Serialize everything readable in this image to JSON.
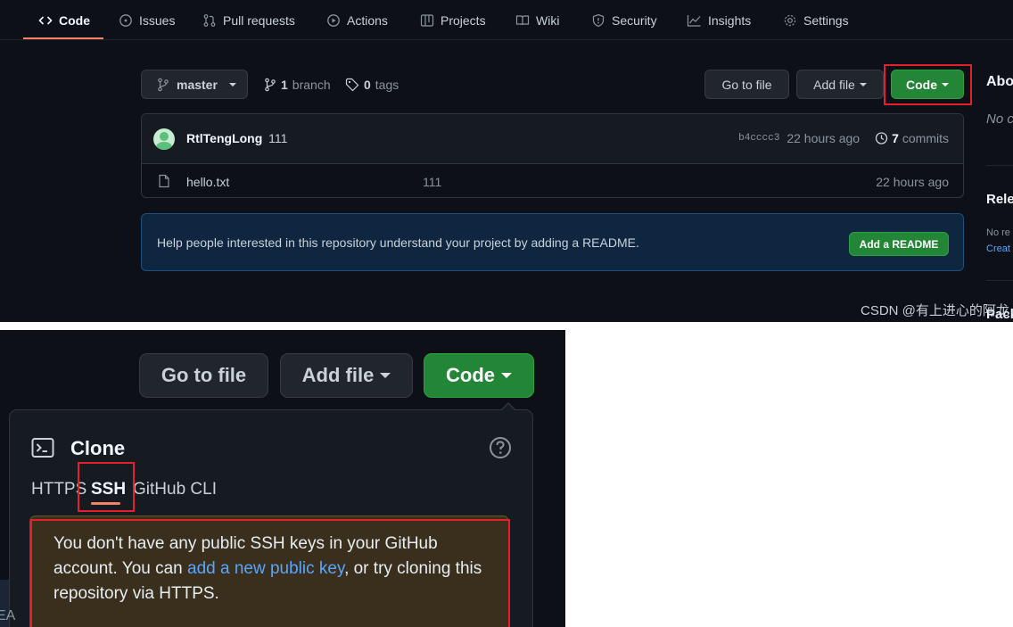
{
  "top": {
    "nav_tabs": [
      {
        "label": "Code",
        "icon": "code-icon",
        "active": true
      },
      {
        "label": "Issues",
        "icon": "issue-icon"
      },
      {
        "label": "Pull requests",
        "icon": "pull-request-icon"
      },
      {
        "label": "Actions",
        "icon": "play-icon"
      },
      {
        "label": "Projects",
        "icon": "table-icon"
      },
      {
        "label": "Wiki",
        "icon": "book-icon"
      },
      {
        "label": "Security",
        "icon": "shield-icon"
      },
      {
        "label": "Insights",
        "icon": "graph-icon"
      },
      {
        "label": "Settings",
        "icon": "gear-icon"
      }
    ],
    "branch_select": "master",
    "branch_count": "1",
    "branch_label": "branch",
    "tag_count": "0",
    "tag_label": "tags",
    "go_to_file": "Go to file",
    "add_file": "Add file",
    "code_button": "Code",
    "commit": {
      "author": "RtlTengLong",
      "message": "111",
      "hash": "b4cccc3",
      "time": "22 hours ago",
      "commits_count": "7",
      "commits_label": "commits"
    },
    "files": [
      {
        "name": "hello.txt",
        "message": "111",
        "time": "22 hours ago"
      }
    ],
    "readme_prompt": "Help people interested in this repository understand your project by adding a README.",
    "add_readme": "Add a README",
    "sidebar": {
      "about": "Abo",
      "about_desc": "No c",
      "releases": "Rele",
      "no_releases": "No re",
      "create": "Creat",
      "packages": "Pack"
    },
    "watermark": "CSDN @有上进心的阿龙"
  },
  "bottom": {
    "go_to_file": "Go to file",
    "add_file": "Add file",
    "code_button": "Code",
    "clone_title": "Clone",
    "tabs": [
      "HTTPS",
      "SSH",
      "GitHub CLI"
    ],
    "warning_pre": "You don't have any public SSH keys in your GitHub account. You can ",
    "warning_link": "add a new public key",
    "warning_post": ", or try cloning this repository via HTTPS.",
    "left_fragment": "EA"
  },
  "colors": {
    "bg": "#0d1117",
    "green": "#238636",
    "link": "#58a6ff",
    "highlight": "#e5202a",
    "tab_underline": "#f78166"
  }
}
